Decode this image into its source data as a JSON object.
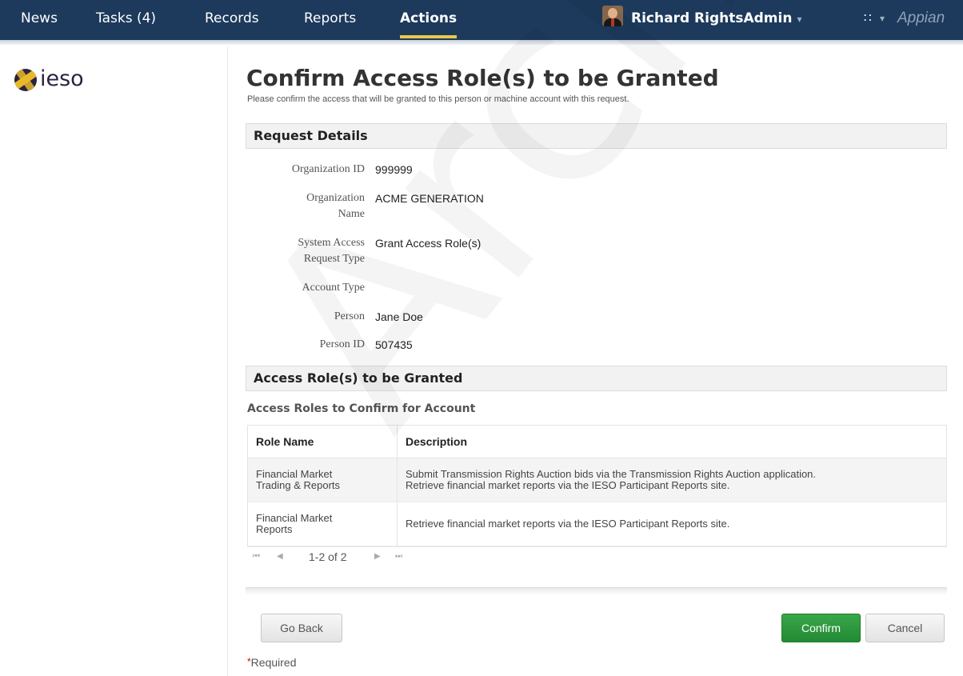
{
  "nav": {
    "items": [
      {
        "label": "News",
        "active": false
      },
      {
        "label": "Tasks (4)",
        "active": false
      },
      {
        "label": "Records",
        "active": false
      },
      {
        "label": "Reports",
        "active": false
      },
      {
        "label": "Actions",
        "active": true
      }
    ],
    "user_name": "Richard RightsAdmin",
    "caret": "▾",
    "apps_icon": "∷",
    "brand": "Appian"
  },
  "logo": {
    "text": "ieso"
  },
  "page": {
    "title": "Confirm Access Role(s) to be Granted",
    "subtitle": "Please confirm the access that will be granted to this person or machine account with this request."
  },
  "request_details": {
    "header": "Request Details",
    "fields": [
      {
        "label": "Organization ID",
        "value": "999999"
      },
      {
        "label": "Organization Name",
        "value": "ACME GENERATION"
      },
      {
        "label": "System Access Request Type",
        "value": "Grant Access Role(s)"
      },
      {
        "label": "Account Type",
        "value": ""
      },
      {
        "label": "Person",
        "value": "Jane Doe"
      },
      {
        "label": "Person ID",
        "value": "507435"
      }
    ]
  },
  "roles": {
    "header": "Access Role(s) to be Granted",
    "caption": "Access Roles to Confirm for Account",
    "columns": [
      "Role Name",
      "Description"
    ],
    "rows": [
      {
        "role": [
          "Financial Market",
          "Trading & Reports"
        ],
        "description": [
          "Submit Transmission Rights Auction bids via the Transmission Rights Auction application.",
          "Retrieve financial market reports via the IESO Participant Reports site."
        ]
      },
      {
        "role": [
          "Financial Market",
          "Reports"
        ],
        "description": [
          "Retrieve financial market reports via the IESO Participant Reports site."
        ]
      }
    ],
    "pager": "1-2 of 2"
  },
  "buttons": {
    "go_back": "Go Back",
    "confirm": "Confirm",
    "cancel": "Cancel"
  },
  "required": {
    "star": "*",
    "label": "Required"
  },
  "watermark": "Archive",
  "colors": {
    "nav_bg": "#1d3a5c",
    "active_underline": "#e7c84a",
    "confirm_green": "#2d9a3d"
  },
  "icons": [
    "user-avatar-icon",
    "apps-grid-icon",
    "ieso-logo-icon",
    "first-page-icon",
    "prev-page-icon",
    "next-page-icon",
    "last-page-icon"
  ]
}
